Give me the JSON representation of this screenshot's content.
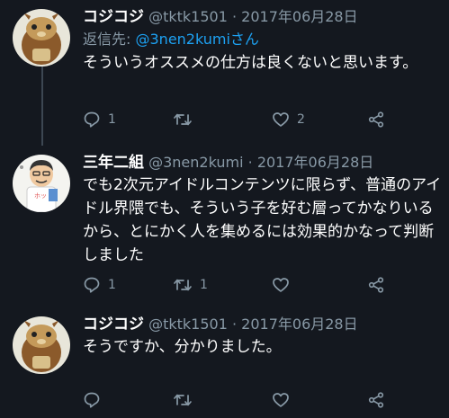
{
  "tweets": [
    {
      "name": "コジコジ",
      "handle": "@tktk1501",
      "separator": "·",
      "date": "2017年06月28日",
      "reply_prefix": "返信先:",
      "reply_handle": "@3nen2kumiさん",
      "text": "そういうオススメの仕方は良くないと思います。",
      "reply_count": "1",
      "retweet_count": "",
      "like_count": "2"
    },
    {
      "name": "三年二組",
      "handle": "@3nen2kumi",
      "separator": "·",
      "date": "2017年06月28日",
      "text": "でも2次元アイドルコンテンツに限らず、普通のアイドル界隈でも、そういう子を好む層ってかなりいるから、とにかく人を集めるには効果的かなって判断しました",
      "reply_count": "1",
      "retweet_count": "1",
      "like_count": ""
    },
    {
      "name": "コジコジ",
      "handle": "@tktk1501",
      "separator": "·",
      "date": "2017年06月28日",
      "text": "そうですか、分かりました。",
      "reply_count": "",
      "retweet_count": "",
      "like_count": ""
    }
  ],
  "icons": {
    "reply": "reply-icon",
    "retweet": "retweet-icon",
    "like": "heart-icon",
    "share": "share-icon"
  },
  "colors": {
    "background": "#14181f",
    "secondary_text": "#8899a6",
    "mention": "#1da1f2",
    "thread_line": "#3d4752"
  }
}
